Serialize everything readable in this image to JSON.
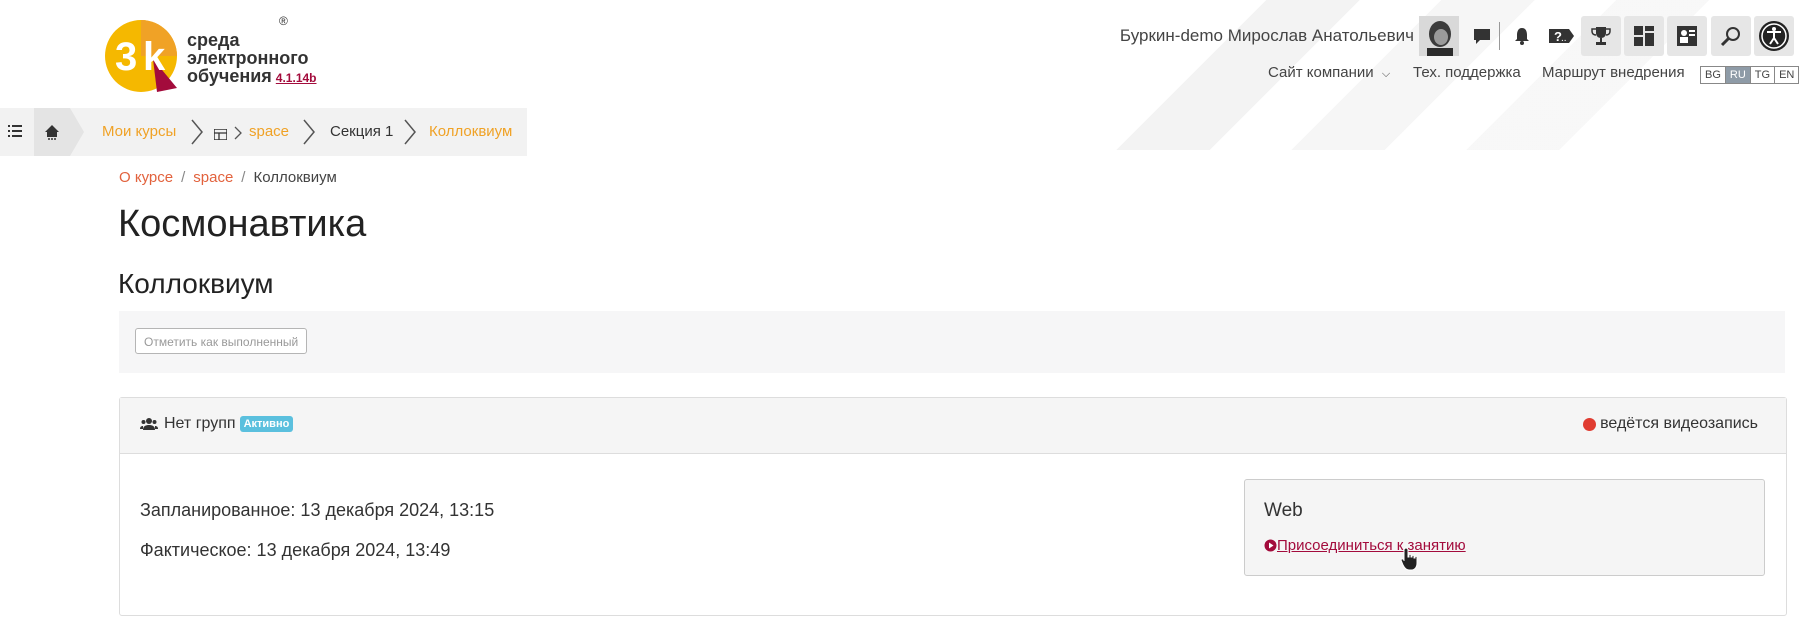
{
  "header": {
    "logo_lines": [
      "среда",
      "электронного",
      "обучения"
    ],
    "logo_version": "4.1.14b",
    "logo_mark": "3k",
    "user_name": "Буркин-demo Мирослав Анатольевич",
    "icons": [
      "chat-icon",
      "bell-icon",
      "help-icon",
      "trophy-icon",
      "dashboard-icon",
      "badge-icon",
      "search-icon",
      "accessibility-icon"
    ],
    "links": {
      "company": "Сайт компании",
      "support": "Тех. поддержка",
      "route": "Маршрут внедрения"
    },
    "languages": [
      "BG",
      "RU",
      "TG",
      "EN"
    ],
    "active_language": "RU"
  },
  "breadcrumb_bar": {
    "my_courses": "Мои курсы",
    "course": "space",
    "section": "Секция 1",
    "activity": "Коллоквиум"
  },
  "breadcrumb": {
    "about": "О курсе",
    "course": "space",
    "current": "Коллоквиум"
  },
  "page": {
    "course_title": "Космонавтика",
    "activity_title": "Коллоквиум",
    "mark_complete": "Отметить как выполненный"
  },
  "session": {
    "groups": "Нет групп",
    "status_badge": "Активно",
    "recording": "ведётся видеозапись",
    "planned": "Запланированное: 13 декабря 2024, 13:15",
    "actual": "Фактическое: 13 декабря 2024, 13:49",
    "web_title": "Web",
    "join_link": " Присоединиться к занятию"
  },
  "colors": {
    "accent_orange": "#f0a226",
    "link_red": "#e2623d",
    "join_crimson": "#a30b3c",
    "badge_blue": "#5bc0de",
    "record_red": "#e03c31"
  }
}
